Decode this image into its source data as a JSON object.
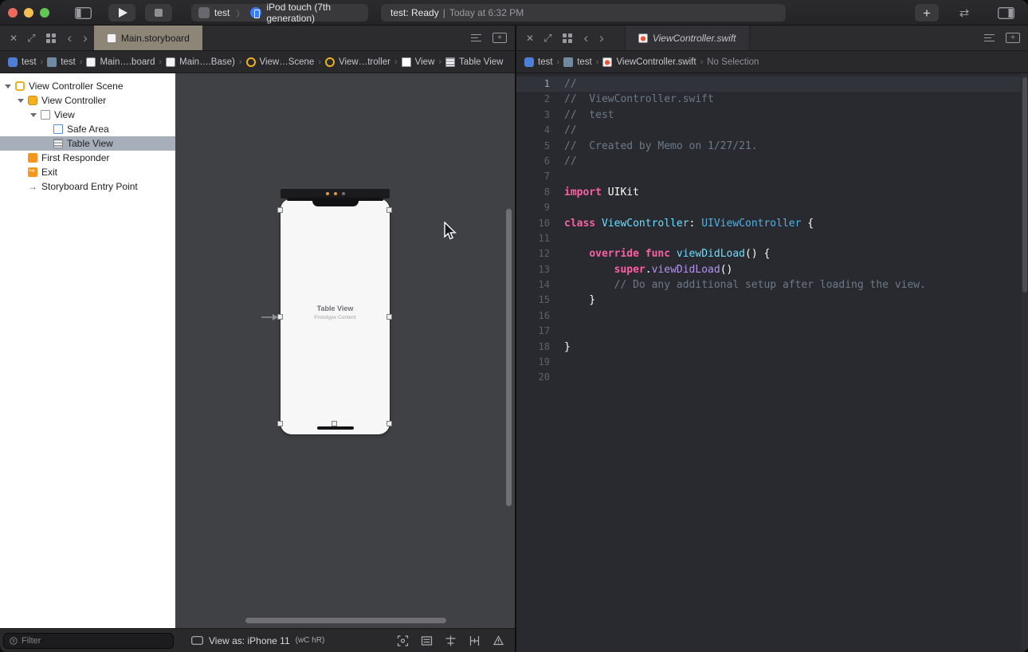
{
  "colors": {
    "traffic_red": "#EC6A5E",
    "traffic_yellow": "#F5BF4F",
    "traffic_green": "#62C554",
    "active_tab": "#8D8677",
    "outline_selection": "#A6AFB9",
    "syntax_keyword": "#FC5FA3",
    "syntax_comment": "#6C7986",
    "syntax_type_declaration": "#6BDFFF",
    "syntax_type": "#4FB2E5",
    "syntax_method_call": "#B591F0",
    "device_dot_orange": "#E09A3E",
    "device_dot_gray": "#707074"
  },
  "icons": {
    "close": "✕",
    "expand": "⤢",
    "back": "‹",
    "forward": "›",
    "plus": "+",
    "swap": "⇄",
    "breadcrumb_separator": "›",
    "scheme_separator": "〉",
    "entry_arrow": "→"
  },
  "toolbar": {
    "scheme": {
      "project": "test",
      "device": "iPod touch (7th generation)"
    },
    "status": {
      "project_status": "test: Ready",
      "separator": "|",
      "time": "Today at 6:32 PM"
    }
  },
  "storyboard_editor": {
    "tab_label": "Main.storyboard",
    "breadcrumbs": [
      {
        "label": "test",
        "icon": "project"
      },
      {
        "label": "test",
        "icon": "folder"
      },
      {
        "label": "Main….board",
        "icon": "storyboard-file"
      },
      {
        "label": "Main….Base)",
        "icon": "storyboard-file"
      },
      {
        "label": "View…Scene",
        "icon": "ring-yellow"
      },
      {
        "label": "View…troller",
        "icon": "ring-yellow"
      },
      {
        "label": "View",
        "icon": "view"
      },
      {
        "label": "Table View",
        "icon": "table-view"
      }
    ],
    "outline": [
      {
        "label": "View Controller Scene",
        "indent": 0,
        "disclosure": true,
        "icon": "scene"
      },
      {
        "label": "View Controller",
        "indent": 1,
        "disclosure": true,
        "icon": "view-controller"
      },
      {
        "label": "View",
        "indent": 2,
        "disclosure": true,
        "icon": "view"
      },
      {
        "label": "Safe Area",
        "indent": 3,
        "disclosure": false,
        "icon": "safe-area"
      },
      {
        "label": "Table View",
        "indent": 3,
        "disclosure": false,
        "icon": "table-view",
        "selected": true
      },
      {
        "label": "First Responder",
        "indent": 1,
        "disclosure": false,
        "icon": "first-responder"
      },
      {
        "label": "Exit",
        "indent": 1,
        "disclosure": false,
        "icon": "exit"
      },
      {
        "label": "Storyboard Entry Point",
        "indent": 1,
        "disclosure": false,
        "icon": "entry-point"
      }
    ],
    "canvas": {
      "device_label_title": "Table View",
      "device_label_subtitle": "Prototype Content"
    },
    "filter_placeholder": "Filter",
    "view_as": {
      "prefix": "View as: iPhone 11 ",
      "traits": "(wC hR)"
    }
  },
  "code_editor": {
    "tab_label": "ViewController.swift",
    "breadcrumbs": [
      {
        "label": "test",
        "icon": "project"
      },
      {
        "label": "test",
        "icon": "folder"
      },
      {
        "label": "ViewController.swift",
        "icon": "swift-file"
      },
      {
        "label": "No Selection",
        "icon": null,
        "muted": true
      }
    ],
    "lines": [
      {
        "n": "1",
        "highlight": true,
        "spans": [
          [
            "c",
            "//"
          ]
        ]
      },
      {
        "n": "2",
        "spans": [
          [
            "c",
            "//  ViewController.swift"
          ]
        ]
      },
      {
        "n": "3",
        "spans": [
          [
            "c",
            "//  test"
          ]
        ]
      },
      {
        "n": "4",
        "spans": [
          [
            "c",
            "//"
          ]
        ]
      },
      {
        "n": "5",
        "spans": [
          [
            "c",
            "//  Created by Memo on 1/27/21."
          ]
        ]
      },
      {
        "n": "6",
        "spans": [
          [
            "c",
            "//"
          ]
        ]
      },
      {
        "n": "7",
        "spans": []
      },
      {
        "n": "8",
        "spans": [
          [
            "k",
            "import"
          ],
          [
            "p",
            " UIKit"
          ]
        ]
      },
      {
        "n": "9",
        "spans": []
      },
      {
        "n": "10",
        "spans": [
          [
            "k",
            "class"
          ],
          [
            "p",
            " "
          ],
          [
            "td",
            "ViewController"
          ],
          [
            "p",
            ": "
          ],
          [
            "t",
            "UIViewController"
          ],
          [
            "p",
            " {"
          ]
        ]
      },
      {
        "n": "11",
        "spans": []
      },
      {
        "n": "12",
        "spans": [
          [
            "p",
            "    "
          ],
          [
            "k",
            "override"
          ],
          [
            "p",
            " "
          ],
          [
            "k",
            "func"
          ],
          [
            "p",
            " "
          ],
          [
            "td",
            "viewDidLoad"
          ],
          [
            "p",
            "() {"
          ]
        ]
      },
      {
        "n": "13",
        "spans": [
          [
            "p",
            "        "
          ],
          [
            "k",
            "super"
          ],
          [
            "p",
            "."
          ],
          [
            "m",
            "viewDidLoad"
          ],
          [
            "p",
            "()"
          ]
        ]
      },
      {
        "n": "14",
        "spans": [
          [
            "p",
            "        "
          ],
          [
            "c",
            "// Do any additional setup after loading the view."
          ]
        ]
      },
      {
        "n": "15",
        "spans": [
          [
            "p",
            "    }"
          ]
        ]
      },
      {
        "n": "16",
        "spans": []
      },
      {
        "n": "17",
        "spans": []
      },
      {
        "n": "18",
        "spans": [
          [
            "p",
            "}"
          ]
        ]
      },
      {
        "n": "19",
        "spans": []
      },
      {
        "n": "20",
        "spans": []
      }
    ]
  }
}
